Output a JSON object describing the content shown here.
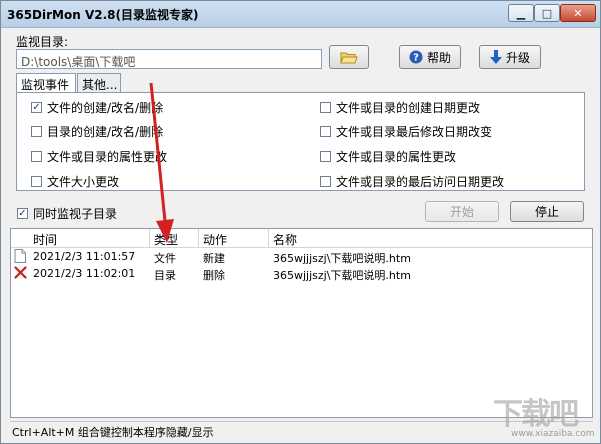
{
  "window": {
    "title": "365DirMon V2.8(目录监视专家)"
  },
  "monitor": {
    "label": "监视目录:",
    "path": "D:\\tools\\桌面\\下载吧",
    "help_label": "帮助",
    "upgrade_label": "升级"
  },
  "tabs": [
    {
      "label": "监视事件"
    },
    {
      "label": "其他..."
    }
  ],
  "events": {
    "left": [
      {
        "label": "文件的创建/改名/删除",
        "checked": true
      },
      {
        "label": "目录的创建/改名/删除",
        "checked": false
      },
      {
        "label": "文件或目录的属性更改",
        "checked": false
      },
      {
        "label": "文件大小更改",
        "checked": false
      }
    ],
    "right": [
      {
        "label": "文件或目录的创建日期更改",
        "checked": false
      },
      {
        "label": "文件或目录最后修改日期改变",
        "checked": false
      },
      {
        "label": "文件或目录的属性更改",
        "checked": false
      },
      {
        "label": "文件或目录的最后访问日期更改",
        "checked": false
      }
    ]
  },
  "subdir": {
    "label": "同时监视子目录",
    "checked": true
  },
  "controls": {
    "start_label": "开始",
    "stop_label": "停止"
  },
  "list": {
    "columns": [
      "时间",
      "类型",
      "动作",
      "名称"
    ],
    "rows": [
      {
        "icon": "file-icon",
        "time": "2021/2/3 11:01:57",
        "type": "文件",
        "action": "新建",
        "name": "365wjjjszj\\下载吧说明.htm"
      },
      {
        "icon": "delete-x-icon",
        "time": "2021/2/3 11:02:01",
        "type": "目录",
        "action": "删除",
        "name": "365wjjjszj\\下载吧说明.htm"
      }
    ]
  },
  "status": {
    "text": "Ctrl+Alt+M 组合键控制本程序隐藏/显示"
  },
  "watermark": {
    "text": "下载吧",
    "sub": "www.xiazaiba.com"
  },
  "colors": {
    "title_bg": "#c4d8ee",
    "close_btn": "#c74a32",
    "annotation_arrow": "#d42020",
    "delete_icon": "#c02020"
  }
}
